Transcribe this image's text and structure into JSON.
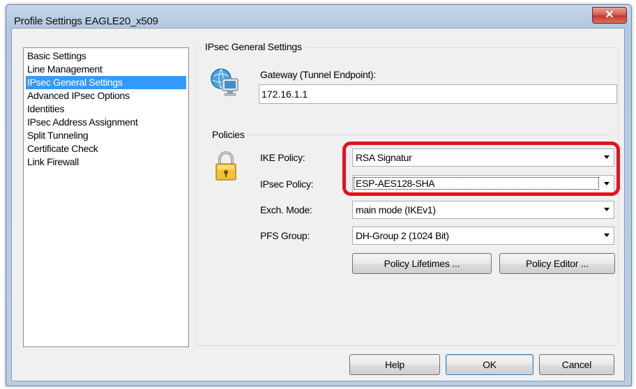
{
  "window": {
    "title": "Profile Settings   EAGLE20_x509",
    "close_glyph": "✕"
  },
  "nav": {
    "items": [
      {
        "label": "Basic Settings",
        "selected": false
      },
      {
        "label": "Line Management",
        "selected": false
      },
      {
        "label": "IPsec General Settings",
        "selected": true
      },
      {
        "label": "Advanced IPsec Options",
        "selected": false
      },
      {
        "label": "Identities",
        "selected": false
      },
      {
        "label": "IPsec Address Assignment",
        "selected": false
      },
      {
        "label": "Split Tunneling",
        "selected": false
      },
      {
        "label": "Certificate Check",
        "selected": false
      },
      {
        "label": "Link Firewall",
        "selected": false
      }
    ]
  },
  "general": {
    "legend": "IPsec General Settings",
    "gateway_label": "Gateway (Tunnel Endpoint):",
    "gateway_value": "172.16.1.1"
  },
  "policies": {
    "legend": "Policies",
    "ike_label": "IKE Policy:",
    "ike_value": "RSA Signatur",
    "ipsec_label": "IPsec Policy:",
    "ipsec_value": "ESP-AES128-SHA",
    "exch_label": "Exch. Mode:",
    "exch_value": "main mode (IKEv1)",
    "pfs_label": "PFS Group:",
    "pfs_value": "DH-Group 2 (1024 Bit)",
    "lifetimes_button": "Policy Lifetimes ...",
    "editor_button": "Policy Editor ..."
  },
  "footer": {
    "help": "Help",
    "ok": "OK",
    "cancel": "Cancel"
  },
  "colors": {
    "selection": "#3399ff",
    "highlight_ring": "#e8101e",
    "close_button": "#c3352a"
  },
  "icons": {
    "gateway": "network-computer-icon",
    "policies": "padlock-icon"
  }
}
